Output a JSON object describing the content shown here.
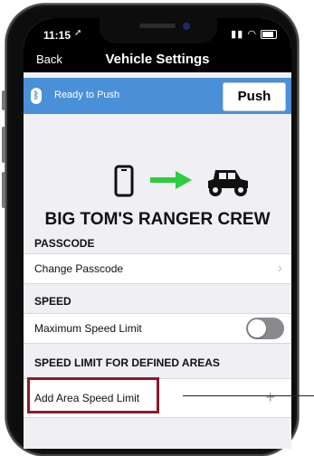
{
  "status_bar": {
    "time": "11:15"
  },
  "nav": {
    "back_label": "Back",
    "title": "Vehicle Settings"
  },
  "bluetooth_bar": {
    "icon": "bluetooth-icon",
    "status": "Ready to Push",
    "push_label": "Push",
    "color": "#4a90d9"
  },
  "hero": {
    "crew_name": "BIG TOM'S RANGER CREW",
    "arrow_color": "#2ecc40"
  },
  "passcode": {
    "header": "PASSCODE",
    "change_label": "Change Passcode"
  },
  "speed": {
    "header": "SPEED",
    "max_label": "Maximum Speed Limit",
    "max_enabled": false
  },
  "areas": {
    "header": "SPEED LIMIT FOR DEFINED AREAS",
    "add_label": "Add Area Speed Limit",
    "add_symbol": "+"
  },
  "annotation": {
    "highlight_color": "#8b1a2b"
  }
}
